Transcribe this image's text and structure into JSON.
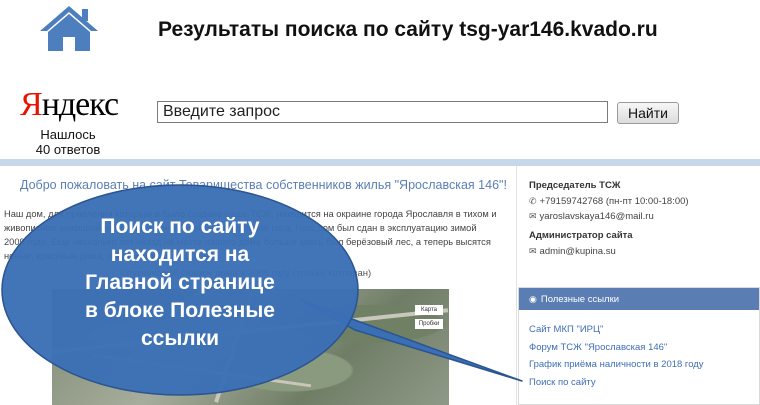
{
  "slide": {
    "title": "Результаты поиска по сайту tsg-yar146.kvado.ru",
    "home_icon": "home-icon"
  },
  "yandex": {
    "logo_first": "Я",
    "logo_rest": "ндекс",
    "found_line1": "Нашлось",
    "found_line2": "40 ответов",
    "search_placeholder": "Введите запрос",
    "search_button": "Найти"
  },
  "site": {
    "welcome": "Добро пожаловать на сайт Товарищества собственников жилья \"Ярославская 146\"!",
    "intro": "Наш дом, для правления которым и было создано наше ТСЖ, находится на окраине города Ярославля в тихом и живописном микрорайоне с живописным названием Липовая гора. Наш дом был сдан в эксплуатацию зимой 2009 года. Ещё несколько лет назад на месте нашего дома больше здесь был берёзовый лес, а теперь высятся новые, красивые дома, среди которых наш дом.",
    "photo_caption": "Спутниковый снимок дома в 2008 году (только котлован)",
    "map_button_map": "Карта",
    "map_button_test": "Пробки",
    "sidebar": {
      "chair_heading": "Председатель ТСЖ",
      "chair_phone": "+79159742768 (пн-пт 10:00-18:00)",
      "chair_email": "yaroslavskaya146@mail.ru",
      "admin_heading": "Администратор сайта",
      "admin_email": "admin@kupina.su",
      "phone_icon": "phone-icon",
      "mail_icon": "envelope-icon"
    },
    "links_panel": {
      "header": "Полезные ссылки",
      "icon": "globe-icon",
      "links": [
        "Сайт МКП \"ИРЦ\"",
        "Форум ТСЖ \"Ярославская 146\"",
        "График приёма наличности в 2018 году",
        "Поиск по сайту"
      ]
    }
  },
  "callout": {
    "line1": "Поиск по сайту",
    "line2": "находится на",
    "line3": "Главной странице",
    "line4": "в блоке Полезные",
    "line5": "ссылки",
    "fill_color": "#3a6fb5"
  }
}
